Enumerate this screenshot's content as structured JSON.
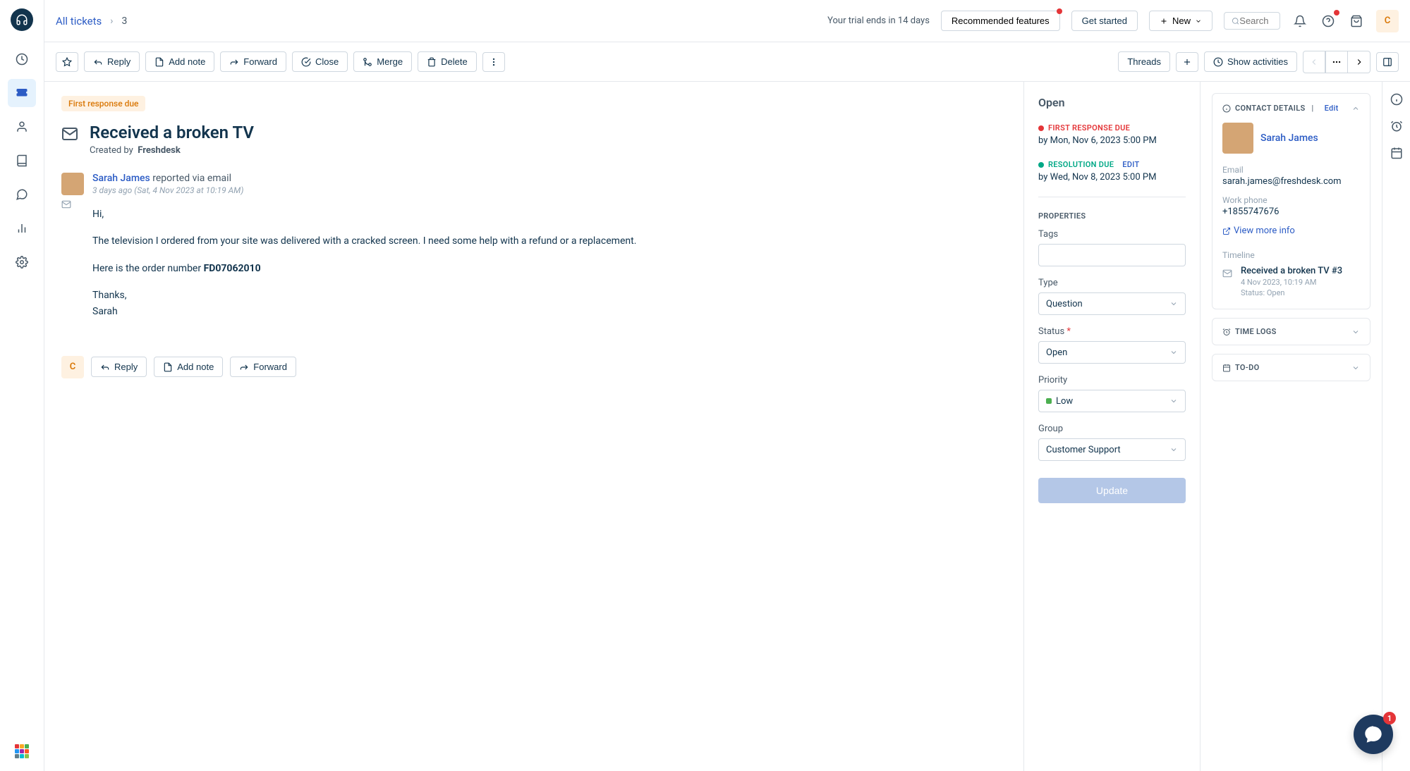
{
  "breadcrumb": {
    "link": "All tickets",
    "id": "3"
  },
  "topbar": {
    "trial": "Your trial ends in 14 days",
    "recommended": "Recommended features",
    "get_started": "Get started",
    "new": "New",
    "search_placeholder": "Search",
    "avatar_letter": "C"
  },
  "toolbar": {
    "reply": "Reply",
    "add_note": "Add note",
    "forward": "Forward",
    "close": "Close",
    "merge": "Merge",
    "delete": "Delete",
    "threads": "Threads",
    "show_activities": "Show activities"
  },
  "ticket": {
    "badge": "First response due",
    "title": "Received a broken TV",
    "created_by_label": "Created by",
    "created_by": "Freshdesk",
    "sender": "Sarah James",
    "via": " reported via email",
    "time": "3 days ago (Sat, 4 Nov 2023 at 10:19 AM)",
    "body": {
      "greeting": "Hi,",
      "para1": "The television I ordered from your site was delivered with a cracked screen. I need some help with a refund or a replacement.",
      "para2_prefix": "Here is the order number ",
      "order_num": "FD07062010",
      "thanks": "Thanks,",
      "sig": "Sarah"
    },
    "reply_bar_avatar": "C"
  },
  "properties": {
    "status_heading": "Open",
    "first_response_label": "FIRST RESPONSE DUE",
    "first_response_val": "by Mon, Nov 6, 2023 5:00 PM",
    "resolution_label": "RESOLUTION DUE",
    "resolution_edit": "Edit",
    "resolution_val": "by Wed, Nov 8, 2023 5:00 PM",
    "section": "PROPERTIES",
    "tags_label": "Tags",
    "type_label": "Type",
    "type_val": "Question",
    "status_label": "Status",
    "status_val": "Open",
    "priority_label": "Priority",
    "priority_val": "Low",
    "group_label": "Group",
    "group_val": "Customer Support",
    "update": "Update"
  },
  "contact": {
    "panel_title": "CONTACT DETAILS",
    "edit": "Edit",
    "name": "Sarah James",
    "email_label": "Email",
    "email": "sarah.james@freshdesk.com",
    "phone_label": "Work phone",
    "phone": "+1855747676",
    "view_more": "View more info",
    "timeline_label": "Timeline",
    "tl_title": "Received a broken TV #3",
    "tl_date": "4 Nov 2023, 10:19 AM",
    "tl_status": "Status: Open",
    "time_logs": "TIME LOGS",
    "todo": "TO-DO"
  },
  "chat": {
    "badge": "1"
  }
}
